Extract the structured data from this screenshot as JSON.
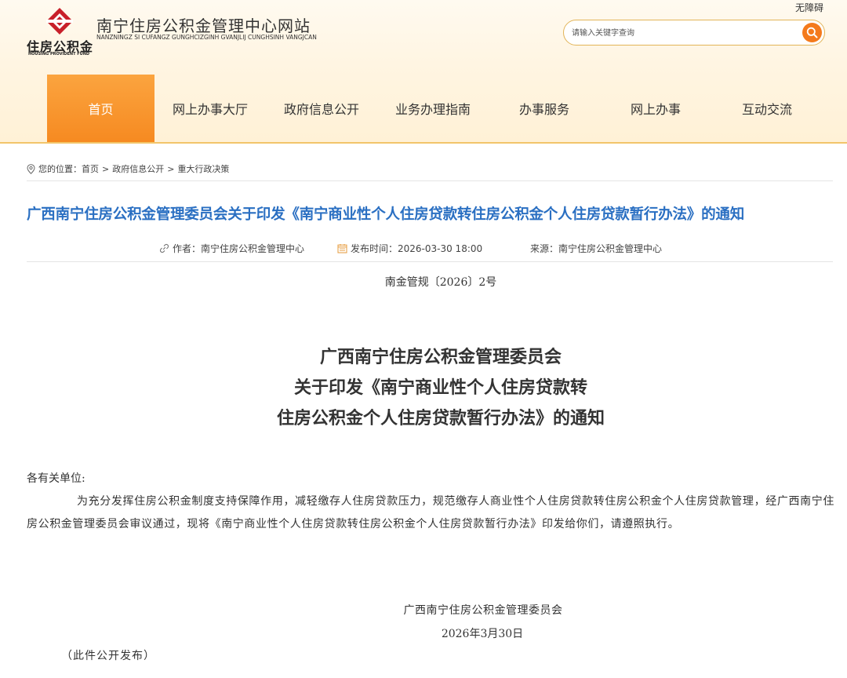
{
  "header": {
    "accessibility": "无障碍",
    "logo_cn": "住房公积金",
    "logo_en": "HOUSING PROVIDENT FUND",
    "site_title": "南宁住房公积金管理中心网站",
    "site_subtitle": "NANZNINGZ SI CUFANGZ GUNGHCIZGINH GVANJLIJ CUNGHSINH VANGJCAN",
    "search_placeholder": "请输入关键字查询"
  },
  "nav": [
    {
      "label": "首页",
      "active": true
    },
    {
      "label": "网上办事大厅"
    },
    {
      "label": "政府信息公开"
    },
    {
      "label": "业务办理指南"
    },
    {
      "label": "办事服务"
    },
    {
      "label": "网上办事"
    },
    {
      "label": "互动交流"
    }
  ],
  "breadcrumb": {
    "prefix": "您的位置：",
    "items": [
      "首页",
      "政府信息公开",
      "重大行政决策"
    ],
    "separator": ">"
  },
  "article": {
    "title": "广西南宁住房公积金管理委员会关于印发《南宁商业性个人住房贷款转住房公积金个人住房贷款暂行办法》的通知",
    "author": "作者：南宁住房公积金管理中心",
    "date": "发布时间：2026-03-30 18:00",
    "source": "来源：南宁住房公积金管理中心",
    "doc_number": "南金管规〔2026〕2号",
    "heading_lines": [
      "广西南宁住房公积金管理委员会",
      "关于印发《南宁商业性个人住房贷款转",
      "住房公积金个人住房贷款暂行办法》的通知"
    ],
    "salutation": "各有关单位:",
    "paragraph": "为充分发挥住房公积金制度支持保障作用，减轻缴存人住房贷款压力，规范缴存人商业性个人住房贷款转住房公积金个人住房贷款管理，经广西南宁住房公积金管理委员会审议通过，现将《南宁商业性个人住房贷款转住房公积金个人住房贷款暂行办法》印发给你们，请遵照执行。",
    "signature": "广西南宁住房公积金管理委员会",
    "sign_date": "2026年3月30日",
    "public_note": "（此件公开发布）"
  },
  "colors": {
    "accent_orange": "#f68a21",
    "title_blue": "#2a6fc2",
    "logo_red": "#c8202a"
  }
}
